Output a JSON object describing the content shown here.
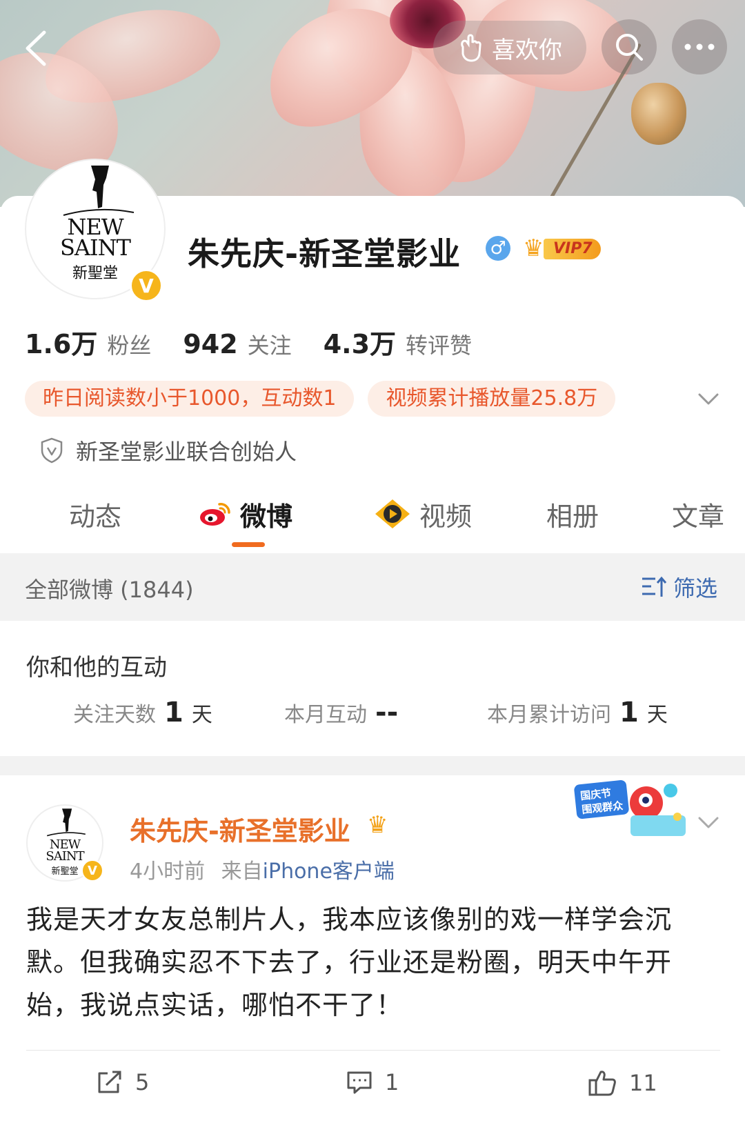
{
  "topbar": {
    "like_label": "喜欢你"
  },
  "profile": {
    "name": "朱先庆-新圣堂影业",
    "gender_symbol": "♂",
    "vip_label": "VIP7",
    "avatar_logo_en_line1": "NEW",
    "avatar_logo_en_line2": "SAINT",
    "avatar_logo_cn": "新聖堂",
    "verified_mark": "V",
    "stats": [
      {
        "num": "1.6万",
        "label": "粉丝"
      },
      {
        "num": "942",
        "label": "关注"
      },
      {
        "num": "4.3万",
        "label": "转评赞"
      }
    ],
    "chips": [
      "昨日阅读数小于1000，互动数1",
      "视频累计播放量25.8万"
    ],
    "role": "新圣堂影业联合创始人"
  },
  "tabs": [
    {
      "label": "动态",
      "icon": ""
    },
    {
      "label": "微博",
      "icon": "weibo-icon"
    },
    {
      "label": "视频",
      "icon": "video-icon"
    },
    {
      "label": "相册",
      "icon": ""
    },
    {
      "label": "文章",
      "icon": ""
    }
  ],
  "filterbar": {
    "all_label": "全部微博 (1844)",
    "filter_label": "筛选"
  },
  "interaction": {
    "title": "你和他的互动",
    "items": [
      {
        "label": "关注天数",
        "value": "1",
        "unit": "天"
      },
      {
        "label": "本月互动",
        "value": "--",
        "unit": ""
      },
      {
        "label": "本月累计访问",
        "value": "1",
        "unit": "天"
      }
    ]
  },
  "post": {
    "author": "朱先庆-新圣堂影业",
    "time": "4小时前",
    "from_prefix": "来自",
    "source": "iPhone客户端",
    "festival_text_1": "国庆节",
    "festival_text_2": "围观群众",
    "text": "我是天才女友总制片人，我本应该像别的戏一样学会沉默。但我确实忍不下去了，行业还是粉圈，明天中午开始，我说点实话，哪怕不干了！",
    "reposts": "5",
    "comments": "1",
    "likes": "11"
  },
  "colors": {
    "accent_orange": "#f06b1f",
    "link_blue": "#3d6ab0",
    "chip_bg": "#fdeee6",
    "chip_text": "#e8572c"
  }
}
